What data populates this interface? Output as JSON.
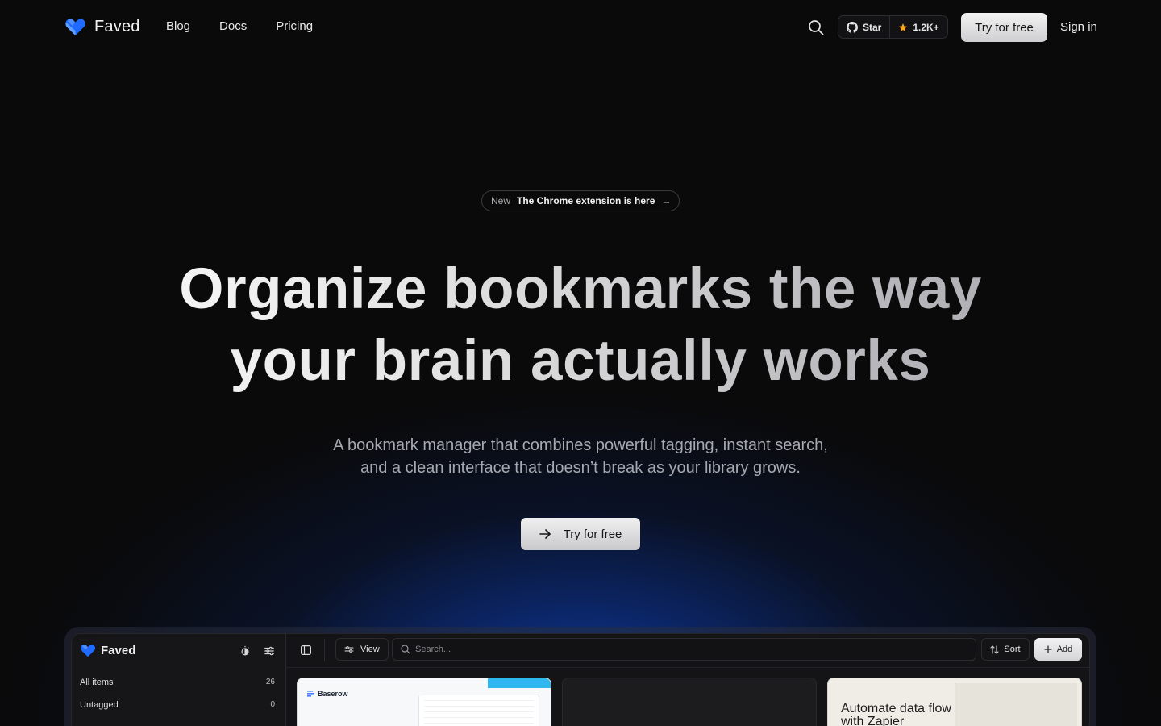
{
  "brand": {
    "name": "Faved",
    "accent": "#1f6bff"
  },
  "nav": {
    "links": [
      "Blog",
      "Docs",
      "Pricing"
    ],
    "github": {
      "star_label": "Star",
      "count": "1.2K+"
    },
    "try_label": "Try for free",
    "signin_label": "Sign in"
  },
  "hero": {
    "badge_new": "New",
    "badge_text": "The Chrome extension is here",
    "headline_line1": "Organize bookmarks the way",
    "headline_line2": "your brain actually works",
    "sub_line1": "A bookmark manager that combines powerful tagging, instant search,",
    "sub_line2": "and a clean interface that doesn’t break as your library grows.",
    "cta_label": "Try for free"
  },
  "app": {
    "brand": "Faved",
    "sidebar": [
      {
        "label": "All items",
        "count": "26"
      },
      {
        "label": "Untagged",
        "count": "0"
      }
    ],
    "toolbar": {
      "view_label": "View",
      "search_placeholder": "Search...",
      "sort_label": "Sort",
      "add_label": "Add"
    },
    "cards": [
      {
        "title": "Baserow"
      },
      {
        "title": ""
      },
      {
        "title": "Automate data flow with Zapier"
      }
    ]
  }
}
